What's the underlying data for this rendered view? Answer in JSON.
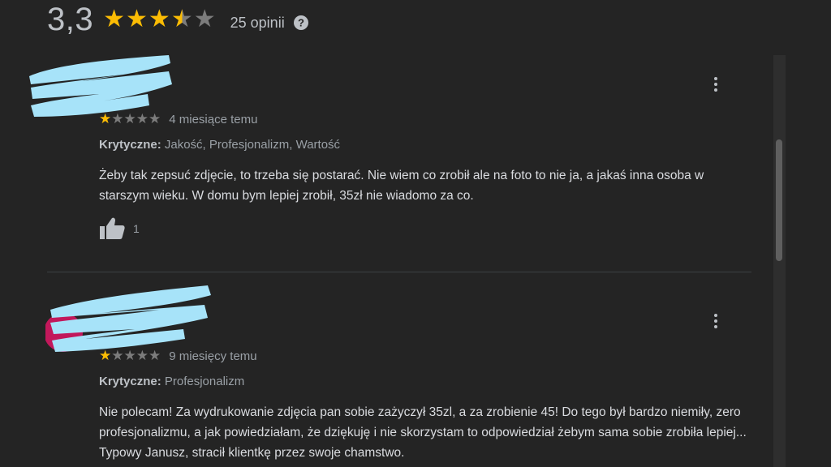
{
  "summary": {
    "rating": "3,3",
    "stars_value": 3.3,
    "reviews_label": "25 opinii",
    "help_icon": "help-circle-icon"
  },
  "reviews": [
    {
      "stars": 1,
      "time": "4 miesiące temu",
      "critical_label": "Krytyczne:",
      "critical_items": " Jakość, Profesjonalizm, Wartość",
      "text": "Żeby tak zepsuć zdjęcie, to trzeba się postarać. Nie wiem co zrobił ale na foto to nie ja, a jakaś inna osoba w starszym wieku. W domu bym lepiej zrobił, 35zł nie wiadomo za co.",
      "likes": "1"
    },
    {
      "stars": 1,
      "time": "9 miesięcy temu",
      "critical_label": "Krytyczne:",
      "critical_items": " Profesjonalizm",
      "text": "Nie polecam! Za wydrukowanie zdjęcia pan sobie zażyczył 35zl, a za zrobienie 45! Do tego był bardzo niemiły, zero profesjonalizmu, a jak powiedziałam, że dziękuję i nie skorzystam to odpowiedział żebym sama sobie zrobiła lepiej... Typowy Janusz, stracił klientkę przez swoje chamstwo."
    }
  ],
  "colors": {
    "background": "#242424",
    "star": "#fbbc04",
    "star_empty": "#7c7c7c",
    "redaction": "#a7e3f9"
  }
}
